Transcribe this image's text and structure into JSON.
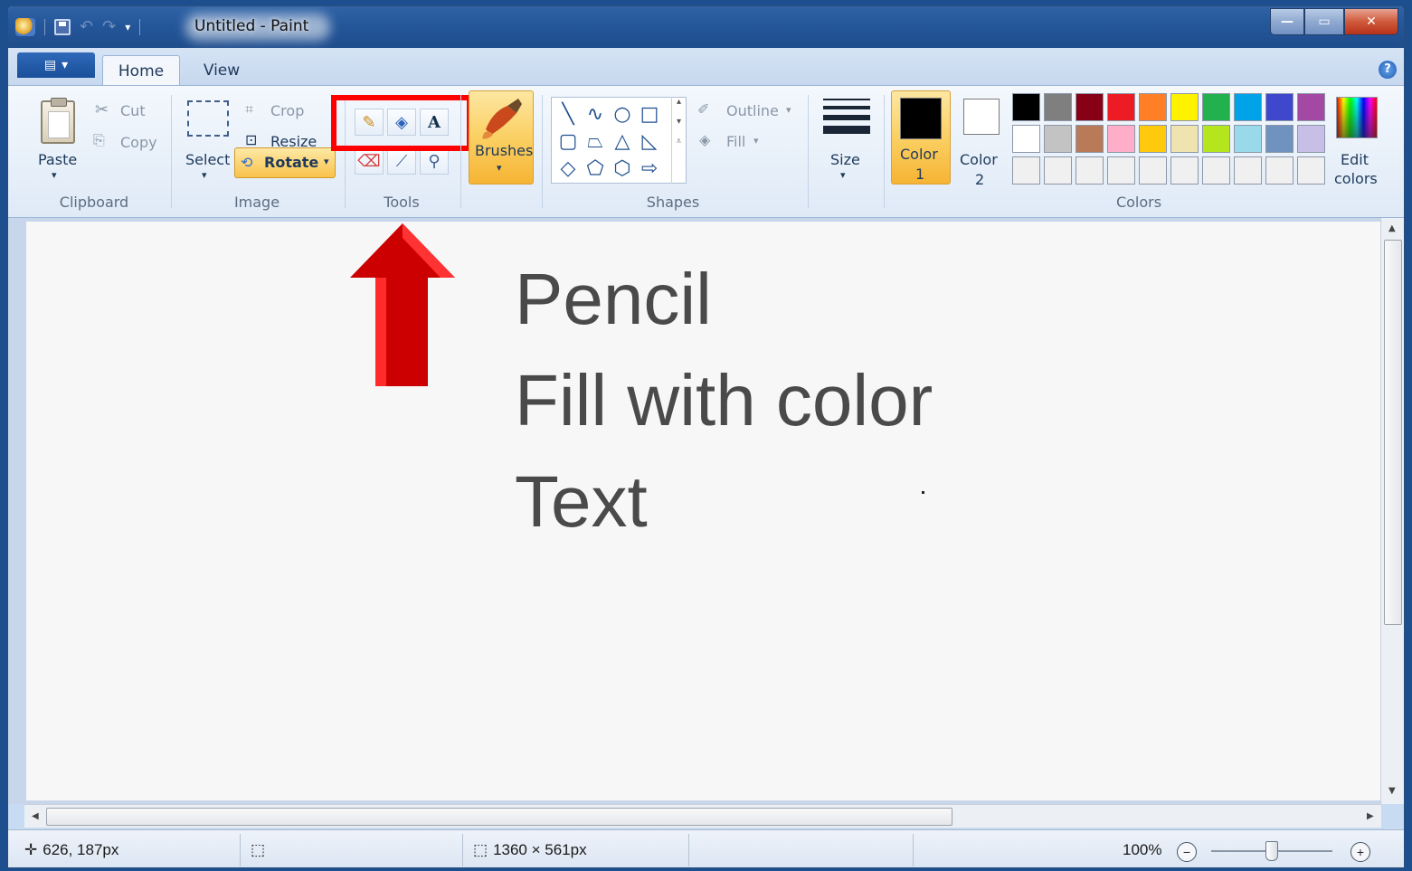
{
  "window": {
    "title": "Untitled - Paint",
    "controls": {
      "minimize": "—",
      "maximize": "▭",
      "close": "✕"
    }
  },
  "tabs": [
    {
      "label": "Home",
      "active": true
    },
    {
      "label": "View",
      "active": false
    }
  ],
  "clipboard": {
    "group": "Clipboard",
    "paste": "Paste",
    "cut": "Cut",
    "copy": "Copy"
  },
  "image": {
    "group": "Image",
    "select": "Select",
    "crop": "Crop",
    "resize": "Resize",
    "rotate": "Rotate"
  },
  "tools": {
    "group": "Tools",
    "highlight_color": "#ff0000"
  },
  "brushes": {
    "label": "Brushes"
  },
  "shapes": {
    "group": "Shapes",
    "outline": "Outline",
    "fill": "Fill"
  },
  "size": {
    "label": "Size"
  },
  "colors": {
    "group": "Colors",
    "color1_label": "Color",
    "color1_num": "1",
    "color2_label": "Color",
    "color2_num": "2",
    "color1": "#000000",
    "color2": "#ffffff",
    "edit_label_line1": "Edit",
    "edit_label_line2": "colors",
    "palette_row1": [
      "#000000",
      "#7f7f7f",
      "#880015",
      "#ed1c24",
      "#ff7f27",
      "#fff200",
      "#22b14c",
      "#00a2e8",
      "#3f48cc",
      "#a349a4"
    ],
    "palette_row2": [
      "#ffffff",
      "#c3c3c3",
      "#b97a57",
      "#ffaec9",
      "#ffc90e",
      "#efe4b0",
      "#b5e61d",
      "#99d9ea",
      "#7092be",
      "#c8bfe7"
    ],
    "palette_row3": [
      "#f0f0f0",
      "#f0f0f0",
      "#f0f0f0",
      "#f0f0f0",
      "#f0f0f0",
      "#f0f0f0",
      "#f0f0f0",
      "#f0f0f0",
      "#f0f0f0",
      "#f0f0f0"
    ]
  },
  "canvas": {
    "line1": "Pencil",
    "line2": "Fill with color",
    "line3": "Text",
    "arrow_color": "#cc0000"
  },
  "status": {
    "cursor_pos": "626, 187px",
    "canvas_size": "1360 × 561px",
    "zoom": "100%",
    "zoom_out": "−",
    "zoom_in": "+"
  }
}
